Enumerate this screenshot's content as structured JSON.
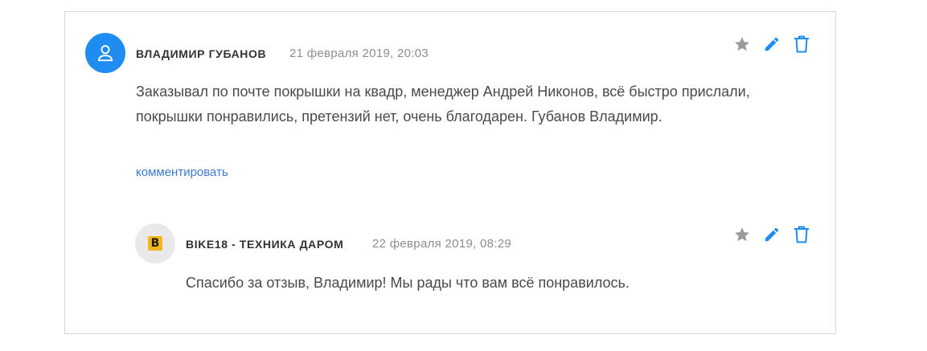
{
  "comments": [
    {
      "author": "Владимир Губанов",
      "date": "21 февраля 2019, 20:03",
      "text": "Заказывал по почте покрышки на квадр, менеджер Андрей Никонов, всё быстро прислали, покрышки понравились, претензий нет, очень благодарен. Губанов Владимир.",
      "reply_link": "комментировать",
      "avatar_icon": "user-icon",
      "avatar_color": "#1e8cf0"
    },
    {
      "author": "BIKE18 - техника даром",
      "date": "22 февраля 2019, 08:29",
      "text": "Спасибо за отзыв, Владимир! Мы рады что вам всё понравилось.",
      "logo_letter": "B",
      "avatar_color": "#e9e9e9",
      "logo_color": "#f3b61b"
    }
  ],
  "colors": {
    "star": "#9b9b9b",
    "edit": "#1e8cf0",
    "delete": "#1e8cf0",
    "link": "#3a7bd5"
  }
}
